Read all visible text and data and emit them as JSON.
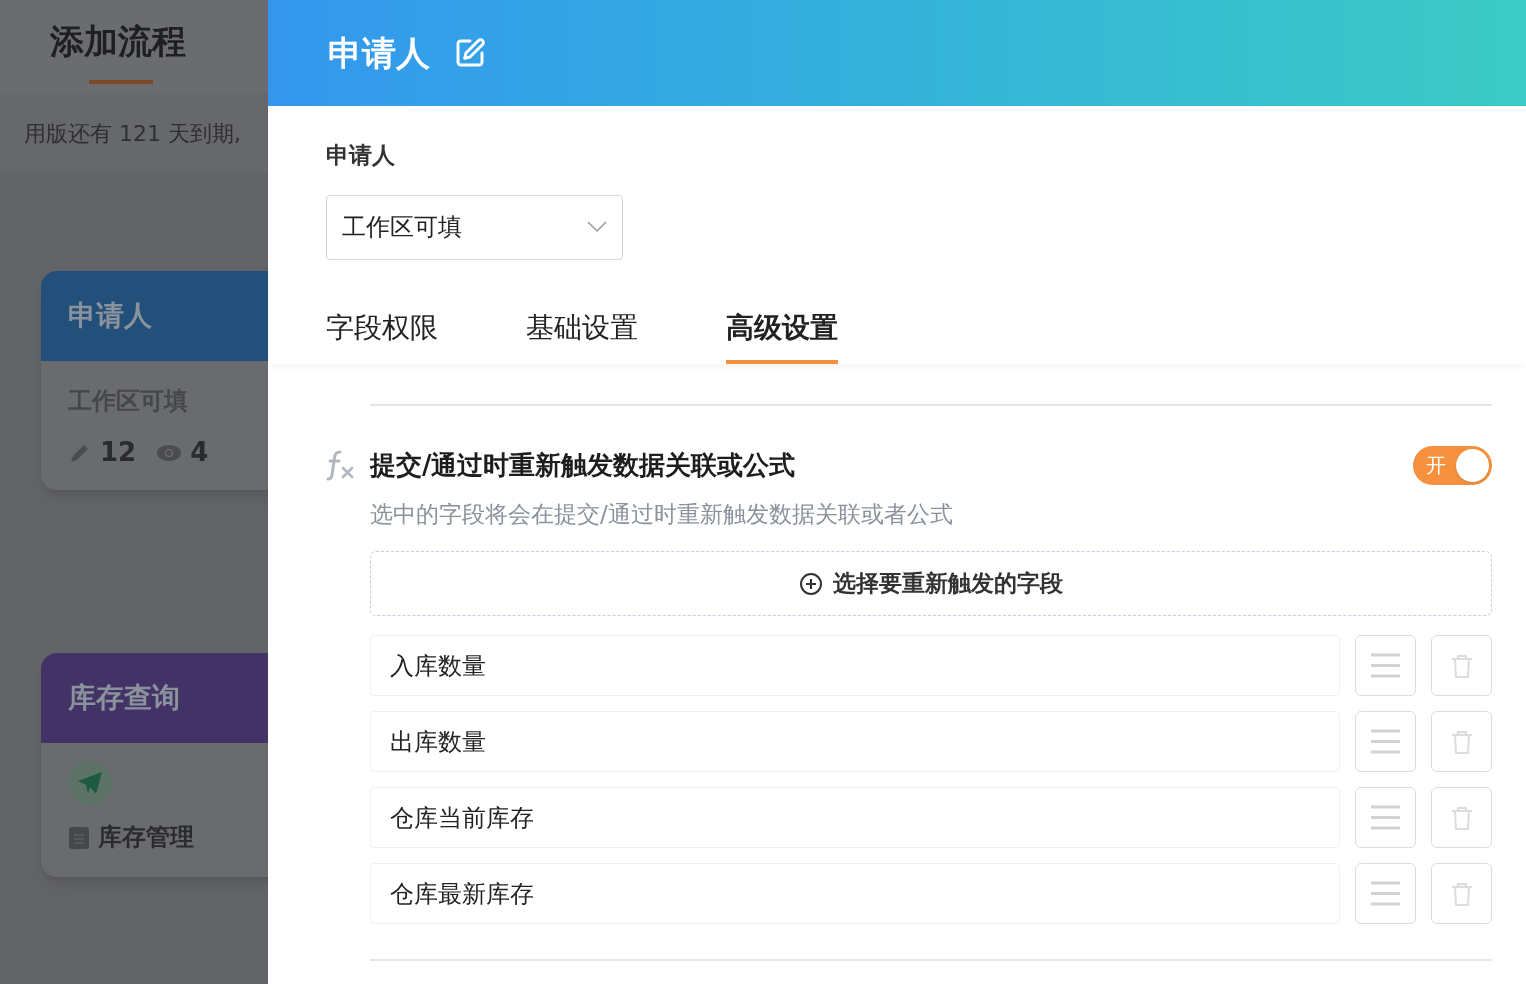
{
  "background_page": {
    "title": "添加流程",
    "notice": "用版还有 121 天到期,",
    "cards": [
      {
        "kind": "applicant",
        "title": "申请人",
        "color": "#22507a",
        "subtitle": "工作区可填",
        "edit_count": "12",
        "view_count": "4"
      },
      {
        "kind": "action",
        "title": "库存查询",
        "color": "#433266",
        "label": "库存管理"
      }
    ]
  },
  "panel": {
    "title": "申请人",
    "field_label": "申请人",
    "select_value": "工作区可填",
    "tabs": [
      {
        "label": "字段权限",
        "selected": false
      },
      {
        "label": "基础设置",
        "selected": false
      },
      {
        "label": "高级设置",
        "selected": true
      }
    ],
    "section": {
      "title": "提交/通过时重新触发数据关联或公式",
      "description": "选中的字段将会在提交/通过时重新触发数据关联或者公式",
      "switch": {
        "on": true,
        "label": "开"
      },
      "add_button": "选择要重新触发的字段",
      "fields": [
        {
          "name": "入库数量"
        },
        {
          "name": "出库数量"
        },
        {
          "name": "仓库当前库存"
        },
        {
          "name": "仓库最新库存"
        }
      ]
    }
  }
}
